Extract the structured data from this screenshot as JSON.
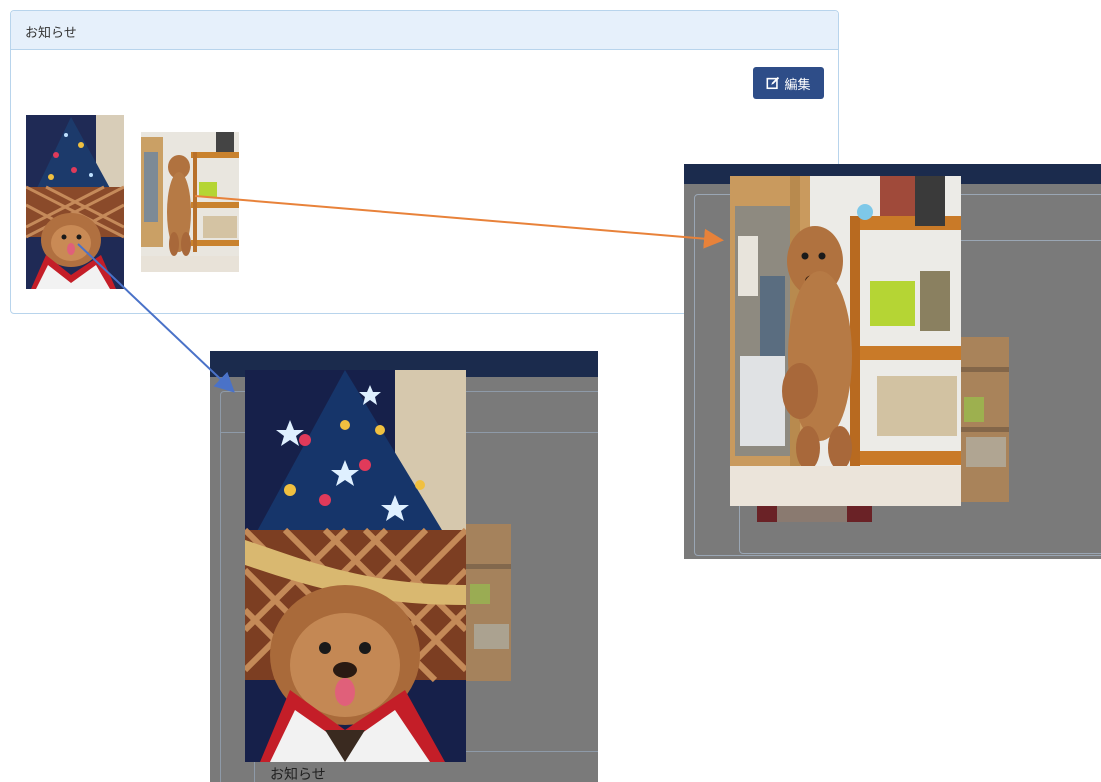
{
  "panel": {
    "heading": "お知らせ",
    "edit_button_label": "編集",
    "edit_icon": "edit-square-icon"
  },
  "overlay_left": {
    "footer_label": "お知らせ"
  },
  "colors": {
    "panel_border": "#b8d4ec",
    "panel_heading_bg": "#e6f0fb",
    "button_bg": "#2e4d88",
    "overlay_topbar": "#1b2b4d",
    "overlay_dim": "#7a7a7a",
    "arrow_orange": "#e8823a",
    "arrow_blue": "#4a72c8"
  }
}
